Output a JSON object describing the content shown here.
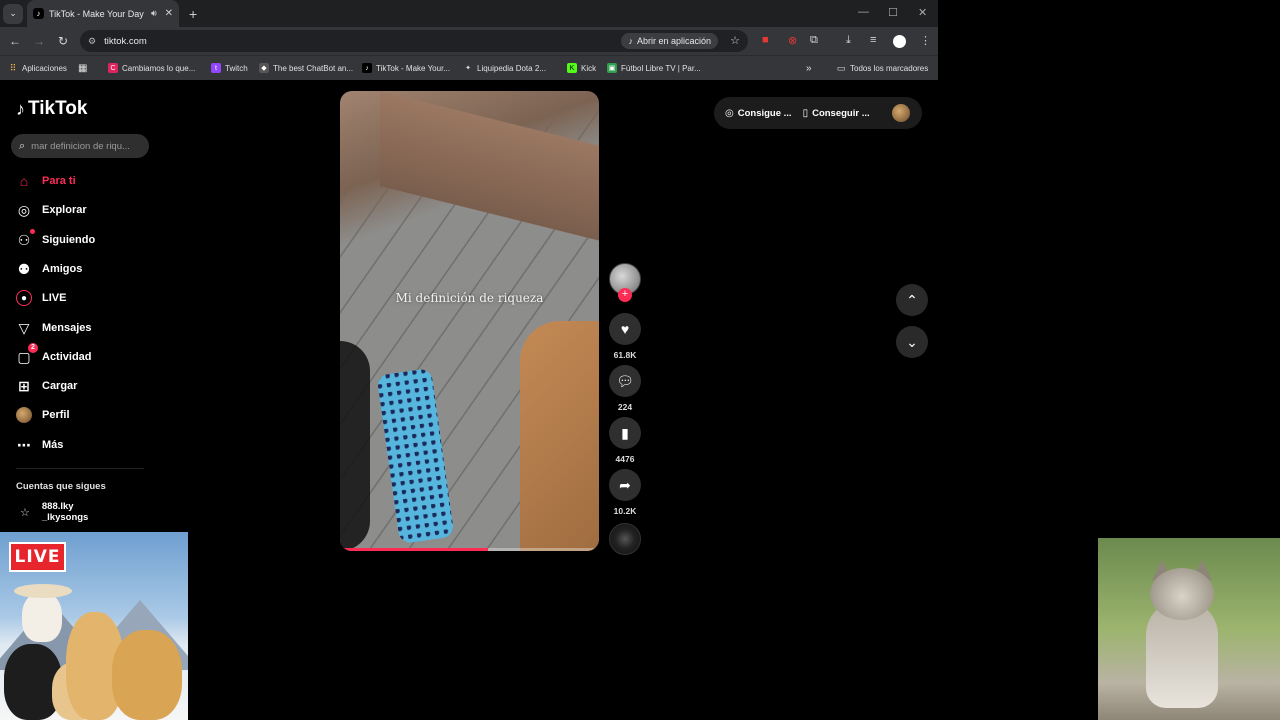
{
  "browser": {
    "tab_title": "TikTok - Make Your Day",
    "url": "tiktok.com",
    "open_in_app": "Abrir en aplicación",
    "bookmarks": [
      {
        "label": "Aplicaciones",
        "color": "#4f7fe0"
      },
      {
        "label": "Cambiamos lo que...",
        "color": "#e0245e"
      },
      {
        "label": "Twitch",
        "color": "#9146ff"
      },
      {
        "label": "The best ChatBot an...",
        "color": "#444444"
      },
      {
        "label": "TikTok - Make Your...",
        "color": "#000000"
      },
      {
        "label": "Liquipedia Dota 2...",
        "color": "#5a5a5a"
      },
      {
        "label": "Kick",
        "color": "#53fc18"
      },
      {
        "label": "Fútbol Libre TV | Par...",
        "color": "#2e9e4f"
      }
    ],
    "bookmarks_more": "»",
    "all_bookmarks": "Todos los marcadores"
  },
  "tiktok": {
    "logo": "TikTok",
    "search_placeholder": "mar definicion de riqu...",
    "nav": [
      {
        "label": "Para ti",
        "icon": "home-icon"
      },
      {
        "label": "Explorar",
        "icon": "compass-icon"
      },
      {
        "label": "Siguiendo",
        "icon": "following-icon"
      },
      {
        "label": "Amigos",
        "icon": "friends-icon"
      },
      {
        "label": "LIVE",
        "icon": "live-icon"
      },
      {
        "label": "Mensajes",
        "icon": "messages-icon"
      },
      {
        "label": "Actividad",
        "icon": "activity-icon",
        "badge": "2"
      },
      {
        "label": "Cargar",
        "icon": "upload-icon"
      },
      {
        "label": "Perfil",
        "icon": "profile-avatar"
      },
      {
        "label": "Más",
        "icon": "more-icon"
      }
    ],
    "accounts_heading": "Cuentas que sigues",
    "account_line1": "888.lky",
    "account_line2": "_lkysongs",
    "video_caption": "Mi definición de riqueza",
    "progress": 0.57,
    "likes": "61.8K",
    "comments": "224",
    "saves": "4476",
    "shares": "10.2K",
    "get_coins": "Consigue ...",
    "get_app": "Conseguir ...",
    "accent": "#fe2c55"
  },
  "overlay": {
    "live_badge": "LIVE"
  }
}
